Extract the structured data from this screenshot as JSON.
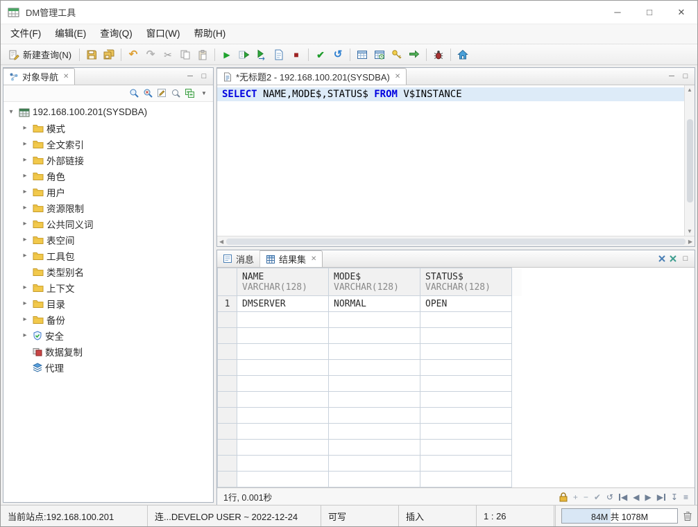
{
  "window": {
    "title": "DM管理工具"
  },
  "icons": {
    "minimize": "─",
    "maximize": "□",
    "close": "✕",
    "undo": "↶",
    "redo": "↷",
    "cut": "✂",
    "run": "▶",
    "stop": "■",
    "commit": "✔",
    "rollback": "↺",
    "twisty_collapsed": "▸",
    "twisty_expanded": "▾",
    "dropdown": "▼",
    "scroll_up": "▲",
    "scroll_down": "▼",
    "scroll_left": "◀",
    "scroll_right": "▶",
    "plus": "+",
    "minus": "−",
    "check": "✔",
    "refresh": "↺",
    "prev": "◀",
    "next": "▶",
    "fetch_down": "↧",
    "fetch_all": "≡"
  },
  "menubar": {
    "items": [
      "文件(F)",
      "编辑(E)",
      "查询(Q)",
      "窗口(W)",
      "帮助(H)"
    ]
  },
  "toolbar": {
    "new_query_label": "新建查询(N)"
  },
  "sidebar": {
    "tab_label": "对象导航",
    "tree": {
      "root": "192.168.100.201(SYSDBA)",
      "items": [
        {
          "label": "模式",
          "icon": "folder",
          "expandable": true
        },
        {
          "label": "全文索引",
          "icon": "folder",
          "expandable": true
        },
        {
          "label": "外部链接",
          "icon": "folder",
          "expandable": true
        },
        {
          "label": "角色",
          "icon": "folder",
          "expandable": true
        },
        {
          "label": "用户",
          "icon": "folder",
          "expandable": true
        },
        {
          "label": "资源限制",
          "icon": "folder",
          "expandable": true
        },
        {
          "label": "公共同义词",
          "icon": "folder",
          "expandable": true
        },
        {
          "label": "表空间",
          "icon": "folder",
          "expandable": true
        },
        {
          "label": "工具包",
          "icon": "folder",
          "expandable": true
        },
        {
          "label": "类型别名",
          "icon": "folder",
          "expandable": false
        },
        {
          "label": "上下文",
          "icon": "folder",
          "expandable": true
        },
        {
          "label": "目录",
          "icon": "folder",
          "expandable": true
        },
        {
          "label": "备份",
          "icon": "folder",
          "expandable": true
        },
        {
          "label": "安全",
          "icon": "shield",
          "expandable": true
        },
        {
          "label": "数据复制",
          "icon": "replication",
          "expandable": false
        },
        {
          "label": "代理",
          "icon": "agent",
          "expandable": false
        }
      ]
    }
  },
  "editor": {
    "tab_label": "*无标题2 - 192.168.100.201(SYSDBA)",
    "sql_tokens": [
      {
        "text": "SELECT",
        "type": "keyword"
      },
      {
        "text": " NAME",
        "type": "plain"
      },
      {
        "text": ",",
        "type": "punct"
      },
      {
        "text": "MODE$",
        "type": "plain"
      },
      {
        "text": ",",
        "type": "punct"
      },
      {
        "text": "STATUS$",
        "type": "plain"
      },
      {
        "text": " ",
        "type": "plain"
      },
      {
        "text": "FROM",
        "type": "keyword"
      },
      {
        "text": " V$INSTANCE",
        "type": "plain"
      }
    ]
  },
  "results": {
    "tabs": [
      {
        "label": "消息"
      },
      {
        "label": "结果集"
      }
    ],
    "columns": [
      {
        "name": "NAME",
        "type": "VARCHAR(128)"
      },
      {
        "name": "MODE$",
        "type": "VARCHAR(128)"
      },
      {
        "name": "STATUS$",
        "type": "VARCHAR(128)"
      }
    ],
    "rows": [
      {
        "num": "1",
        "name": "DMSERVER",
        "mode": "NORMAL",
        "status": "OPEN"
      }
    ],
    "footer_status": "1行, 0.001秒"
  },
  "statusbar": {
    "site": "当前站点:192.168.100.201",
    "connection": "连...DEVELOP USER ~ 2022-12-24",
    "write_mode": "可写",
    "insert_mode": "插入",
    "caret_position": "1 : 26",
    "memory": "84M 共 1078M"
  },
  "colors": {
    "keyword": "#0000e0",
    "current_line": "#ddebf8",
    "folder": "#f2c94c"
  }
}
